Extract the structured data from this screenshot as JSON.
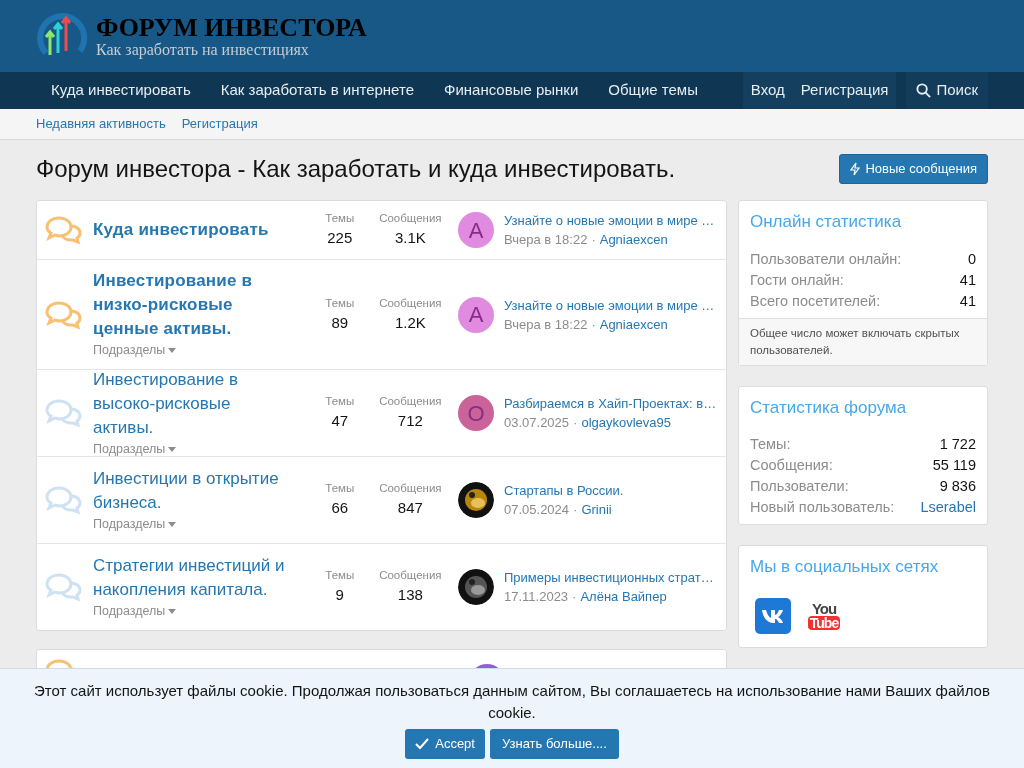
{
  "logo": {
    "title": "ФОРУМ ИНВЕСТОРА",
    "subtitle": "Как заработать на инвестициях"
  },
  "nav": {
    "items": [
      {
        "label": "Куда инвестировать"
      },
      {
        "label": "Как заработать в интернете"
      },
      {
        "label": "Финансовые рынки"
      },
      {
        "label": "Общие темы"
      }
    ],
    "account": [
      "Вход",
      "Регистрация"
    ],
    "search": "Поиск"
  },
  "subnav": [
    "Недавняя активность",
    "Регистрация"
  ],
  "page_title": "Форум инвестора - Как заработать и куда инвестировать.",
  "new_posts_button": "Новые сообщения",
  "forums": [
    {
      "title": "Куда инвестировать",
      "unread": true,
      "threads_label": "Темы",
      "threads": "225",
      "messages_label": "Сообщения",
      "messages": "3.1K",
      "avatar": {
        "kind": "letter",
        "letter": "A",
        "color": "#e08ae0"
      },
      "last_title": "Узнайте о новые эмоции в мире …",
      "last_date": "Вчера в 18:22",
      "separator": "·",
      "last_user": "Agniaexcen"
    },
    {
      "title": "Инвестирование в низко-рисковые ценные активы.",
      "unread": true,
      "subforums": "Подразделы",
      "threads_label": "Темы",
      "threads": "89",
      "messages_label": "Сообщения",
      "messages": "1.2K",
      "avatar": {
        "kind": "letter",
        "letter": "A",
        "color": "#e08ae0"
      },
      "last_title": "Узнайте о новые эмоции в мире …",
      "last_date": "Вчера в 18:22",
      "separator": "·",
      "last_user": "Agniaexcen"
    },
    {
      "title": "Инвестирование в высоко-рисковые активы.",
      "unread": false,
      "subforums": "Подразделы",
      "threads_label": "Темы",
      "threads": "47",
      "messages_label": "Сообщения",
      "messages": "712",
      "avatar": {
        "kind": "letter",
        "letter": "O",
        "color": "#c9639a"
      },
      "last_title": "Разбираемся в Хайп-Проектах: в…",
      "last_date": "03.07.2025",
      "separator": "·",
      "last_user": "olgaykovleva95"
    },
    {
      "title": "Инвестиции в открытие бизнеса.",
      "unread": false,
      "subforums": "Подразделы",
      "threads_label": "Темы",
      "threads": "66",
      "messages_label": "Сообщения",
      "messages": "847",
      "last_title": "Стартапы в России.",
      "last_date": "07.05.2024",
      "separator": "·",
      "last_user": "Grinii"
    },
    {
      "title": "Стратегии инвестиций и накопления капитала.",
      "unread": false,
      "subforums": "Подразделы",
      "threads_label": "Темы",
      "threads": "9",
      "messages_label": "Сообщения",
      "messages": "138",
      "last_title": "Примеры инвестиционных страт…",
      "last_date": "17.11.2023",
      "separator": "·",
      "last_user": "Алёна Вайпер"
    }
  ],
  "second_block": {
    "unread": true
  },
  "online_stats": {
    "title": "Онлайн статистика",
    "rows": [
      {
        "label": "Пользователи онлайн:",
        "value": "0"
      },
      {
        "label": "Гости онлайн:",
        "value": "41"
      },
      {
        "label": "Всего посетителей:",
        "value": "41"
      }
    ],
    "footer": "Общее число может включать скрытых пользователей."
  },
  "forum_stats": {
    "title": "Статистика форума",
    "rows": [
      {
        "label": "Темы:",
        "value": "1 722",
        "link": false
      },
      {
        "label": "Сообщения:",
        "value": "55 119",
        "link": false
      },
      {
        "label": "Пользователи:",
        "value": "9 836",
        "link": false
      },
      {
        "label": "Новый пользователь:",
        "value": "Lserabel",
        "link": true
      }
    ]
  },
  "social": {
    "title": "Мы в социальных сетях",
    "youtube": {
      "top": "You",
      "bottom": "Tube"
    }
  },
  "cookie": {
    "text": "Этот сайт использует файлы cookie. Продолжая пользоваться данным сайтом, Вы соглашаетесь на использование нами Ваших файлов cookie.",
    "accept": "Accept",
    "more": "Узнать больше...."
  }
}
